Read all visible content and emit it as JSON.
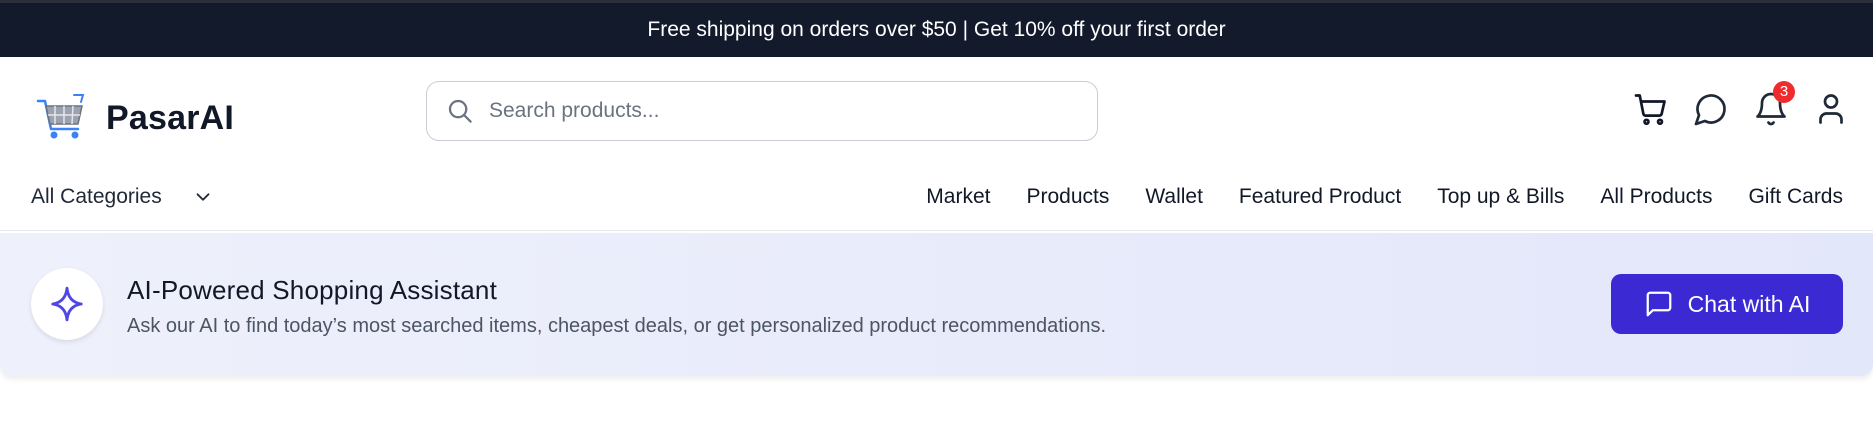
{
  "announcement": "Free shipping on orders over $50 | Get 10% off your first order",
  "brand": {
    "name": "PasarAI",
    "logo_icon": "shopping-cart-logo"
  },
  "search": {
    "placeholder": "Search products...",
    "value": ""
  },
  "header_icons": [
    {
      "name": "cart-icon"
    },
    {
      "name": "chat-icon"
    },
    {
      "name": "bell-icon",
      "badge": "3"
    },
    {
      "name": "user-icon"
    }
  ],
  "notifications": {
    "count": "3"
  },
  "nav": {
    "categories_label": "All Categories",
    "links": [
      "Market",
      "Products",
      "Wallet",
      "Featured Product",
      "Top up & Bills",
      "All Products",
      "Gift Cards"
    ]
  },
  "banner": {
    "title": "AI-Powered Shopping Assistant",
    "subtitle": "Ask our AI to find today’s most searched items, cheapest deals, or get personalized product recommendations.",
    "button_label": "Chat with AI",
    "icon": "sparkle-icon"
  },
  "colors": {
    "topbar_bg": "#131a2b",
    "accent": "#3b29d4",
    "badge": "#ef2b2d",
    "banner_bg": "#e8ebfa"
  }
}
